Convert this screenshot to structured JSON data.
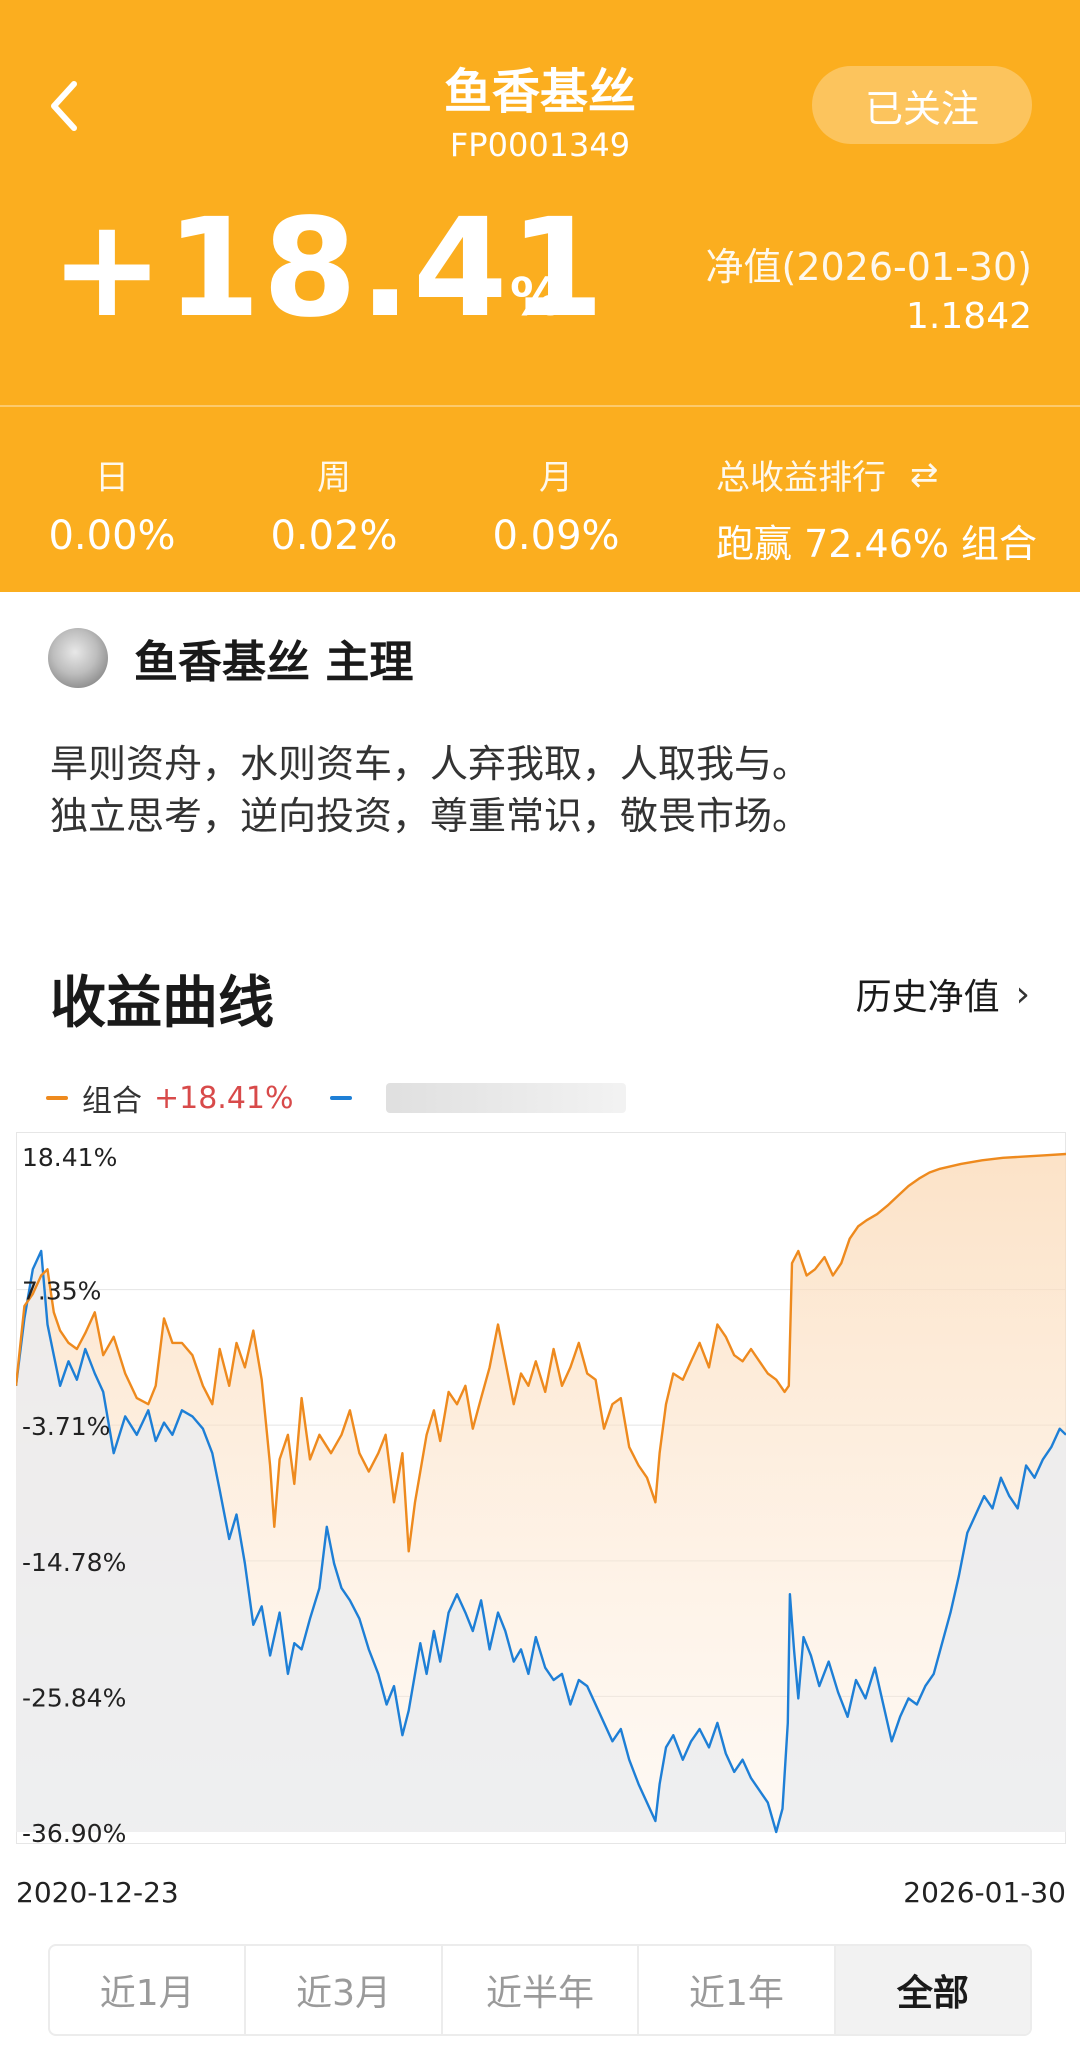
{
  "header": {
    "title": "鱼香基丝",
    "code": "FP0001349",
    "follow_label": "已关注",
    "total_return": "+18.41",
    "percent_sign": "%",
    "nav_label": "净值(2026-01-30)",
    "nav_value": "1.1842"
  },
  "stats": [
    {
      "label": "日",
      "value": "0.00%"
    },
    {
      "label": "周",
      "value": "0.02%"
    },
    {
      "label": "月",
      "value": "0.09%"
    }
  ],
  "rank": {
    "label": "总收益排行",
    "value": "跑赢 72.46% 组合"
  },
  "manager": {
    "name": "鱼香基丝 主理",
    "motto_line1": "旱则资舟，水则资车，人弃我取，人取我与。",
    "motto_line2": "独立思考，逆向投资，尊重常识，敬畏市场。"
  },
  "section": {
    "title": "收益曲线",
    "history_label": "历史净值"
  },
  "legend": {
    "series1_name": "组合",
    "series1_return": "+18.41%"
  },
  "colors": {
    "brand": "#FBAE1F",
    "portfolio_line": "#EE8A1E",
    "benchmark_line": "#1E7FD6",
    "positive": "#d84a4a"
  },
  "chart_data": {
    "type": "line",
    "x_start": "2020-12-23",
    "x_end": "2026-01-30",
    "y_ticks": [
      "18.41%",
      "7.35%",
      "-3.71%",
      "-14.78%",
      "-25.84%",
      "-36.90%"
    ],
    "ylim": [
      -36.9,
      18.41
    ],
    "series": [
      {
        "name": "组合",
        "color": "#EE8A1E",
        "points": [
          [
            0.0,
            -0.5
          ],
          [
            0.008,
            6.0
          ],
          [
            0.016,
            7.0
          ],
          [
            0.024,
            8.5
          ],
          [
            0.03,
            9.0
          ],
          [
            0.036,
            5.5
          ],
          [
            0.042,
            4.0
          ],
          [
            0.05,
            3.0
          ],
          [
            0.058,
            2.5
          ],
          [
            0.066,
            3.8
          ],
          [
            0.075,
            5.5
          ],
          [
            0.083,
            2.0
          ],
          [
            0.093,
            3.5
          ],
          [
            0.104,
            0.5
          ],
          [
            0.115,
            -1.5
          ],
          [
            0.126,
            -2.0
          ],
          [
            0.133,
            -0.5
          ],
          [
            0.141,
            5.0
          ],
          [
            0.149,
            3.0
          ],
          [
            0.158,
            3.0
          ],
          [
            0.168,
            2.0
          ],
          [
            0.178,
            -0.5
          ],
          [
            0.187,
            -2.0
          ],
          [
            0.194,
            2.5
          ],
          [
            0.203,
            -0.5
          ],
          [
            0.21,
            3.0
          ],
          [
            0.218,
            1.0
          ],
          [
            0.226,
            4.0
          ],
          [
            0.234,
            0.0
          ],
          [
            0.242,
            -7.0
          ],
          [
            0.246,
            -12.0
          ],
          [
            0.251,
            -6.5
          ],
          [
            0.259,
            -4.5
          ],
          [
            0.265,
            -8.5
          ],
          [
            0.272,
            -1.5
          ],
          [
            0.28,
            -6.5
          ],
          [
            0.289,
            -4.5
          ],
          [
            0.3,
            -6.0
          ],
          [
            0.31,
            -4.5
          ],
          [
            0.318,
            -2.5
          ],
          [
            0.327,
            -6.0
          ],
          [
            0.336,
            -7.5
          ],
          [
            0.345,
            -6.0
          ],
          [
            0.352,
            -4.5
          ],
          [
            0.36,
            -10.0
          ],
          [
            0.368,
            -6.0
          ],
          [
            0.374,
            -14.0
          ],
          [
            0.38,
            -10.0
          ],
          [
            0.385,
            -7.5
          ],
          [
            0.391,
            -4.5
          ],
          [
            0.398,
            -2.5
          ],
          [
            0.404,
            -5.0
          ],
          [
            0.412,
            -1.0
          ],
          [
            0.42,
            -2.0
          ],
          [
            0.428,
            -0.5
          ],
          [
            0.435,
            -4.0
          ],
          [
            0.443,
            -1.5
          ],
          [
            0.451,
            1.0
          ],
          [
            0.459,
            4.5
          ],
          [
            0.466,
            1.5
          ],
          [
            0.474,
            -2.0
          ],
          [
            0.481,
            0.5
          ],
          [
            0.488,
            -0.5
          ],
          [
            0.495,
            1.5
          ],
          [
            0.504,
            -1.0
          ],
          [
            0.512,
            2.5
          ],
          [
            0.52,
            -0.5
          ],
          [
            0.528,
            1.0
          ],
          [
            0.536,
            3.0
          ],
          [
            0.544,
            0.5
          ],
          [
            0.552,
            0.0
          ],
          [
            0.56,
            -4.0
          ],
          [
            0.568,
            -2.0
          ],
          [
            0.576,
            -1.5
          ],
          [
            0.584,
            -5.5
          ],
          [
            0.593,
            -7.0
          ],
          [
            0.601,
            -8.0
          ],
          [
            0.609,
            -10.0
          ],
          [
            0.613,
            -6.0
          ],
          [
            0.619,
            -2.0
          ],
          [
            0.626,
            0.5
          ],
          [
            0.635,
            0.0
          ],
          [
            0.643,
            1.5
          ],
          [
            0.651,
            3.0
          ],
          [
            0.66,
            1.0
          ],
          [
            0.668,
            4.5
          ],
          [
            0.676,
            3.5
          ],
          [
            0.684,
            2.0
          ],
          [
            0.692,
            1.5
          ],
          [
            0.7,
            2.5
          ],
          [
            0.708,
            1.5
          ],
          [
            0.716,
            0.5
          ],
          [
            0.724,
            0.0
          ],
          [
            0.732,
            -1.0
          ],
          [
            0.736,
            -0.5
          ],
          [
            0.739,
            9.5
          ],
          [
            0.745,
            10.5
          ],
          [
            0.753,
            8.5
          ],
          [
            0.761,
            9.0
          ],
          [
            0.77,
            10.0
          ],
          [
            0.778,
            8.5
          ],
          [
            0.786,
            9.5
          ],
          [
            0.794,
            11.5
          ],
          [
            0.802,
            12.5
          ],
          [
            0.81,
            13.0
          ],
          [
            0.82,
            13.5
          ],
          [
            0.83,
            14.2
          ],
          [
            0.84,
            15.0
          ],
          [
            0.85,
            15.8
          ],
          [
            0.86,
            16.4
          ],
          [
            0.87,
            16.9
          ],
          [
            0.88,
            17.2
          ],
          [
            0.9,
            17.6
          ],
          [
            0.92,
            17.9
          ],
          [
            0.94,
            18.1
          ],
          [
            0.96,
            18.2
          ],
          [
            0.98,
            18.3
          ],
          [
            1.0,
            18.41
          ]
        ]
      },
      {
        "name": "",
        "color": "#1E7FD6",
        "points": [
          [
            0.0,
            -0.5
          ],
          [
            0.008,
            5.0
          ],
          [
            0.016,
            9.0
          ],
          [
            0.024,
            10.5
          ],
          [
            0.03,
            4.5
          ],
          [
            0.036,
            2.0
          ],
          [
            0.042,
            -0.5
          ],
          [
            0.05,
            1.5
          ],
          [
            0.058,
            0.0
          ],
          [
            0.066,
            2.5
          ],
          [
            0.075,
            0.5
          ],
          [
            0.083,
            -1.0
          ],
          [
            0.093,
            -6.0
          ],
          [
            0.104,
            -3.0
          ],
          [
            0.115,
            -4.5
          ],
          [
            0.126,
            -2.5
          ],
          [
            0.133,
            -5.0
          ],
          [
            0.141,
            -3.5
          ],
          [
            0.149,
            -4.5
          ],
          [
            0.158,
            -2.5
          ],
          [
            0.168,
            -3.0
          ],
          [
            0.178,
            -4.0
          ],
          [
            0.187,
            -6.0
          ],
          [
            0.194,
            -9.0
          ],
          [
            0.203,
            -13.0
          ],
          [
            0.21,
            -11.0
          ],
          [
            0.218,
            -15.0
          ],
          [
            0.226,
            -20.0
          ],
          [
            0.234,
            -18.5
          ],
          [
            0.242,
            -22.5
          ],
          [
            0.251,
            -19.0
          ],
          [
            0.259,
            -24.0
          ],
          [
            0.265,
            -21.5
          ],
          [
            0.272,
            -22.0
          ],
          [
            0.28,
            -19.5
          ],
          [
            0.289,
            -17.0
          ],
          [
            0.296,
            -12.0
          ],
          [
            0.303,
            -15.0
          ],
          [
            0.31,
            -17.0
          ],
          [
            0.318,
            -18.0
          ],
          [
            0.327,
            -19.5
          ],
          [
            0.336,
            -22.0
          ],
          [
            0.345,
            -24.0
          ],
          [
            0.353,
            -26.5
          ],
          [
            0.36,
            -25.0
          ],
          [
            0.368,
            -29.0
          ],
          [
            0.374,
            -27.0
          ],
          [
            0.38,
            -24.0
          ],
          [
            0.385,
            -21.5
          ],
          [
            0.391,
            -24.0
          ],
          [
            0.398,
            -20.5
          ],
          [
            0.404,
            -23.0
          ],
          [
            0.412,
            -19.0
          ],
          [
            0.42,
            -17.5
          ],
          [
            0.428,
            -19.0
          ],
          [
            0.435,
            -20.5
          ],
          [
            0.443,
            -18.0
          ],
          [
            0.451,
            -22.0
          ],
          [
            0.459,
            -19.0
          ],
          [
            0.466,
            -20.5
          ],
          [
            0.474,
            -23.0
          ],
          [
            0.481,
            -22.0
          ],
          [
            0.488,
            -24.0
          ],
          [
            0.495,
            -21.0
          ],
          [
            0.504,
            -23.5
          ],
          [
            0.512,
            -24.5
          ],
          [
            0.52,
            -24.0
          ],
          [
            0.528,
            -26.5
          ],
          [
            0.536,
            -24.5
          ],
          [
            0.544,
            -25.0
          ],
          [
            0.552,
            -26.5
          ],
          [
            0.56,
            -28.0
          ],
          [
            0.568,
            -29.5
          ],
          [
            0.576,
            -28.5
          ],
          [
            0.584,
            -31.0
          ],
          [
            0.593,
            -33.0
          ],
          [
            0.601,
            -34.5
          ],
          [
            0.609,
            -36.0
          ],
          [
            0.613,
            -33.0
          ],
          [
            0.619,
            -30.0
          ],
          [
            0.626,
            -29.0
          ],
          [
            0.635,
            -31.0
          ],
          [
            0.643,
            -29.5
          ],
          [
            0.651,
            -28.5
          ],
          [
            0.66,
            -30.0
          ],
          [
            0.668,
            -28.0
          ],
          [
            0.676,
            -30.5
          ],
          [
            0.684,
            -32.0
          ],
          [
            0.692,
            -31.0
          ],
          [
            0.7,
            -32.5
          ],
          [
            0.708,
            -33.5
          ],
          [
            0.716,
            -34.5
          ],
          [
            0.724,
            -36.9
          ],
          [
            0.73,
            -35.0
          ],
          [
            0.735,
            -28.0
          ],
          [
            0.737,
            -17.5
          ],
          [
            0.741,
            -22.0
          ],
          [
            0.745,
            -26.0
          ],
          [
            0.75,
            -21.0
          ],
          [
            0.757,
            -22.5
          ],
          [
            0.765,
            -25.0
          ],
          [
            0.774,
            -23.0
          ],
          [
            0.783,
            -25.5
          ],
          [
            0.792,
            -27.5
          ],
          [
            0.8,
            -24.5
          ],
          [
            0.809,
            -26.0
          ],
          [
            0.818,
            -23.5
          ],
          [
            0.826,
            -26.5
          ],
          [
            0.834,
            -29.5
          ],
          [
            0.842,
            -27.5
          ],
          [
            0.85,
            -26.0
          ],
          [
            0.858,
            -26.5
          ],
          [
            0.866,
            -25.0
          ],
          [
            0.874,
            -24.0
          ],
          [
            0.882,
            -21.5
          ],
          [
            0.89,
            -19.0
          ],
          [
            0.898,
            -16.0
          ],
          [
            0.906,
            -12.5
          ],
          [
            0.914,
            -11.0
          ],
          [
            0.922,
            -9.5
          ],
          [
            0.93,
            -10.5
          ],
          [
            0.938,
            -8.0
          ],
          [
            0.946,
            -9.5
          ],
          [
            0.954,
            -10.5
          ],
          [
            0.962,
            -7.0
          ],
          [
            0.97,
            -8.0
          ],
          [
            0.978,
            -6.5
          ],
          [
            0.986,
            -5.5
          ],
          [
            0.994,
            -4.0
          ],
          [
            1.0,
            -4.5
          ]
        ]
      }
    ]
  },
  "tabs": [
    {
      "label": "近1月",
      "active": false
    },
    {
      "label": "近3月",
      "active": false
    },
    {
      "label": "近半年",
      "active": false
    },
    {
      "label": "近1年",
      "active": false
    },
    {
      "label": "全部",
      "active": true
    }
  ]
}
